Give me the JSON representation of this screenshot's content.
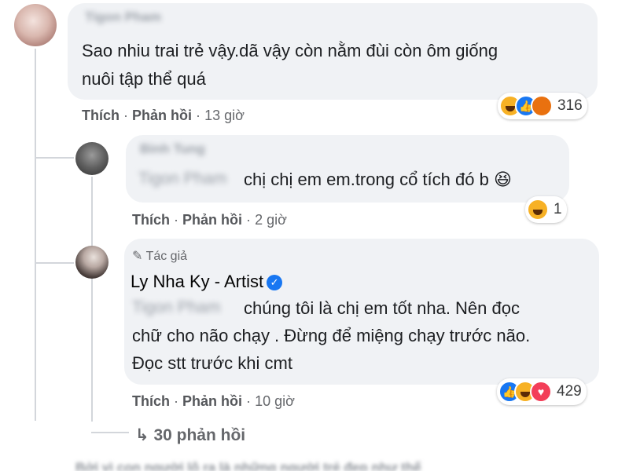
{
  "comments": [
    {
      "author": "Tigon Pham",
      "text_lines": [
        "Sao nhiu trai trẻ vậy.dã vậy còn nằm đùi còn ôm giống",
        "nuôi tập thể quá"
      ],
      "actions": {
        "like": "Thích",
        "reply": "Phản hồi",
        "time": "13 giờ"
      },
      "reaction_count": "316",
      "reactions": [
        "haha-icon",
        "like-icon",
        "angry-icon"
      ]
    },
    {
      "author": "Binh Tung",
      "mention": "Tigon Pham",
      "text": "chị chị em em.trong cổ tích đó b",
      "emoji": "😆",
      "actions": {
        "like": "Thích",
        "reply": "Phản hồi",
        "time": "2 giờ"
      },
      "reaction_count": "1",
      "reactions": [
        "haha-icon"
      ]
    },
    {
      "author_tag": "Tác giả",
      "author": "Ly Nha Ky - Artist",
      "verified_glyph": "✓",
      "mention": "Tigon Pham",
      "text_lines": [
        "chúng tôi là chị em tốt nha. Nên đọc",
        "chữ cho não chạy . Đừng để miệng chạy trước não.",
        "Đọc stt trước khi cmt"
      ],
      "actions": {
        "like": "Thích",
        "reply": "Phản hồi",
        "time": "10 giờ"
      },
      "reaction_count": "429",
      "reactions": [
        "like-icon",
        "haha-icon",
        "love-icon"
      ]
    }
  ],
  "more_replies": {
    "arrow": "↳",
    "label": "30 phản hồi"
  },
  "separator": "·",
  "pen_glyph": "✎",
  "footer_blurred": "Bởi vì con người lộ ra là những người trẻ đẹp như thế"
}
